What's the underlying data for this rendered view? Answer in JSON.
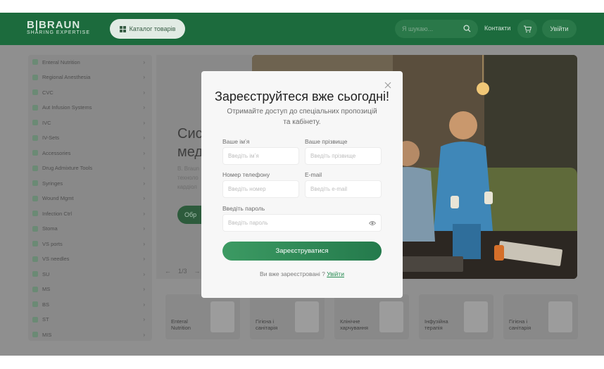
{
  "header": {
    "logo_main": "B|BRAUN",
    "logo_sub": "SHARING EXPERTISE",
    "catalog_label": "Каталог товарів",
    "search_placeholder": "Я шукаю...",
    "contacts_label": "Контакти",
    "login_label": "Увійти"
  },
  "sidebar": {
    "items": [
      {
        "label": "Enteral Nutrition"
      },
      {
        "label": "Regional Anesthesia"
      },
      {
        "label": "CVC"
      },
      {
        "label": "Aut Infusion Systems"
      },
      {
        "label": "IVC"
      },
      {
        "label": "IV-Sets"
      },
      {
        "label": "Accessories"
      },
      {
        "label": "Drug Admixture Tools"
      },
      {
        "label": "Syringes"
      },
      {
        "label": "Wound Mgmt"
      },
      {
        "label": "Infection Ctrl"
      },
      {
        "label": "Stoma"
      },
      {
        "label": "VS ports"
      },
      {
        "label": "VS needles"
      },
      {
        "label": "SU"
      },
      {
        "label": "MS"
      },
      {
        "label": "BS"
      },
      {
        "label": "ST"
      },
      {
        "label": "MIS"
      }
    ]
  },
  "hero": {
    "title_line1": "Сис",
    "title_line2": "мед",
    "text_line1": "B. Braun",
    "text_line2": "техноло",
    "text_line3": "кардіол",
    "button_label": "Обр",
    "slider_counter": "1/3"
  },
  "categories": [
    {
      "label": "Enteral Nutrition"
    },
    {
      "label": "Гігієна і санітарія"
    },
    {
      "label": "Клінічне харчування"
    },
    {
      "label": "Інфузійна терапія"
    },
    {
      "label": "Гігієна і санітарія"
    }
  ],
  "modal": {
    "title": "Зареєструйтеся вже сьогодні!",
    "subtitle": "Отримайте доступ до спеціальних пропозицій та кабінету.",
    "first_name_label": "Ваше імʼя",
    "first_name_placeholder": "Введіть імʼя",
    "last_name_label": "Ваше прізвище",
    "last_name_placeholder": "Введіть прізвище",
    "phone_label": "Номер телефону",
    "phone_placeholder": "Введіть номер",
    "email_label": "E-mail",
    "email_placeholder": "Введіть e-mail",
    "password_label": "Введіть пароль",
    "password_placeholder": "Введіть пароль",
    "submit_label": "Зареєструватися",
    "already_text": "Ви вже зареєстровані ?",
    "signin_link": "Увійти"
  },
  "colors": {
    "brand_green": "#1c6b3d",
    "button_green": "#2f8a57",
    "link_green": "#238a4f"
  }
}
